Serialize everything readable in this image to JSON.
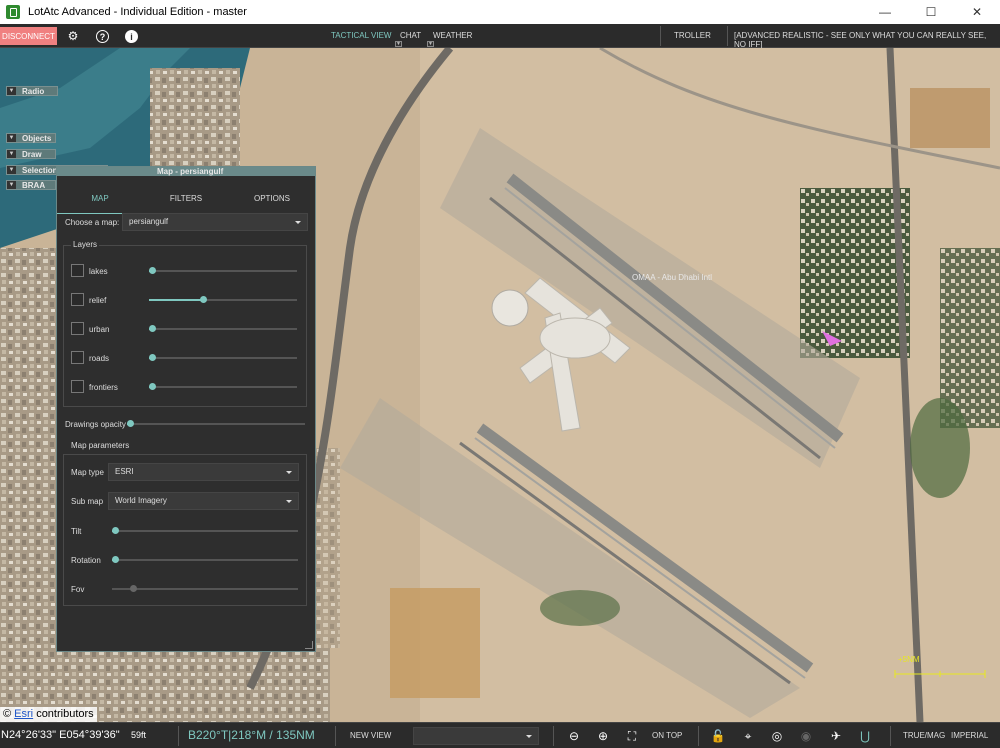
{
  "window": {
    "title": "LotAtc Advanced - Individual Edition - master",
    "minimize_glyph": "—",
    "maximize_glyph": "☐",
    "close_glyph": "✕"
  },
  "toolbar": {
    "disconnect_label": "DISCONNECT",
    "settings_icon": "gear-icon",
    "help_icon": "help-icon",
    "info_icon": "info-icon",
    "help_glyph": "?",
    "info_glyph": "i",
    "gear_glyph": "⚙",
    "tabs": [
      {
        "label": "TACTICAL VIEW",
        "active": true
      },
      {
        "label": "CHAT",
        "active": false
      },
      {
        "label": "WEATHER",
        "active": false
      }
    ],
    "tab_arrow_glyph": "▼",
    "troller_label": "TROLLER",
    "realism_label": "[ADVANCED REALISTIC - SEE ONLY WHAT YOU CAN REALLY SEE, NO IFF]"
  },
  "side_panels": [
    {
      "label": "Radio"
    },
    {
      "label": "Objects"
    },
    {
      "label": "Draw"
    },
    {
      "label": "Selection's properties"
    },
    {
      "label": "BRAA"
    }
  ],
  "collapse_glyph": "▼",
  "map_panel": {
    "title": "Map - persiangulf",
    "tabs": [
      {
        "label": "MAP",
        "active": true
      },
      {
        "label": "FILTERS",
        "active": false
      },
      {
        "label": "OPTIONS",
        "active": false
      }
    ],
    "choose_map_label": "Choose a map:",
    "choose_map_value": "persiangulf",
    "layers_label": "Layers",
    "layers": [
      {
        "name": "lakes",
        "checked": false,
        "level": 0.0
      },
      {
        "name": "relief",
        "checked": false,
        "level": 0.36
      },
      {
        "name": "urban",
        "checked": false,
        "level": 0.0
      },
      {
        "name": "roads",
        "checked": false,
        "level": 0.0
      },
      {
        "name": "frontiers",
        "checked": false,
        "level": 0.0
      }
    ],
    "drawings_opacity_label": "Drawings opacity",
    "drawings_opacity_level": 0.0,
    "map_params_label": "Map parameters",
    "map_type_label": "Map type",
    "map_type_value": "ESRI",
    "sub_map_label": "Sub map",
    "sub_map_value": "World Imagery",
    "tilt_label": "Tilt",
    "tilt_level": 0.0,
    "rotation_label": "Rotation",
    "rotation_level": 0.0,
    "fov_label": "Fov",
    "fov_level": 0.1
  },
  "map": {
    "airport_label": "OMAA - Abu Dhabi Intl",
    "scale_label": "+5NM",
    "attribution_prefix": "©",
    "attribution_link": "Esri",
    "attribution_suffix": "contributors",
    "colors": {
      "sand": "#c9b497",
      "water": "#2d6a7a",
      "runway": "#8a8a86",
      "contact": "#e070e0",
      "scale": "#e8e820"
    }
  },
  "bottom": {
    "coordinates": "N24°26'33\" E054°39'36\"",
    "altitude": "59ft",
    "bearing": "B220°T|218°M / 135NM",
    "new_view_label": "NEW VIEW",
    "view_combo_value": "",
    "zoom_out_icon": "zoom-out-icon",
    "zoom_in_icon": "zoom-in-icon",
    "fit_icon": "fit-icon",
    "on_top_label": "ON TOP",
    "lock_icon": "unlock-icon",
    "center_icon": "crosshair-icon",
    "target_icon": "target-icon",
    "eye_icon": "eye-icon",
    "plane_icon": "aircraft-icon",
    "magnet_icon": "magnet-icon",
    "true_mag_label": "TRUE/MAG",
    "imperial_label": "IMPERIAL",
    "icon_glyphs": {
      "zoom_out": "⊖",
      "zoom_in": "⊕",
      "fit": "⛶",
      "lock": "🔓",
      "center": "⌖",
      "target": "◎",
      "eye": "◉",
      "plane": "✈",
      "magnet": "⋃"
    }
  }
}
